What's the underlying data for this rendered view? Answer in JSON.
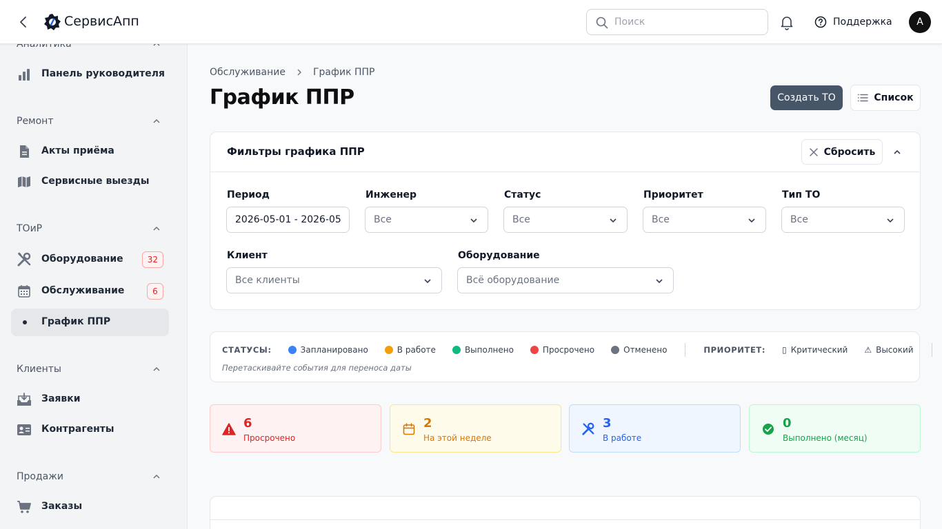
{
  "header": {
    "app_name": "СервисАпп",
    "search_placeholder": "Поиск",
    "support_label": "Поддержка",
    "avatar_initial": "A"
  },
  "sidebar": {
    "sections": [
      {
        "title": "Аналитика",
        "items": [
          {
            "label": "Панель руководителя",
            "icon": "bar-chart-icon"
          }
        ]
      },
      {
        "title": "Ремонт",
        "items": [
          {
            "label": "Акты приёма",
            "icon": "document-icon"
          },
          {
            "label": "Сервисные выезды",
            "icon": "map-icon"
          }
        ]
      },
      {
        "title": "ТОиР",
        "items": [
          {
            "label": "Оборудование",
            "icon": "tools-icon",
            "badge": "32"
          },
          {
            "label": "Обслуживание",
            "icon": "calendar-icon",
            "badge": "6"
          },
          {
            "label": "График ППР",
            "icon": "dot-icon",
            "active": true
          }
        ]
      },
      {
        "title": "Клиенты",
        "items": [
          {
            "label": "Заявки",
            "icon": "inbox-icon"
          },
          {
            "label": "Контрагенты",
            "icon": "contact-card-icon"
          }
        ]
      },
      {
        "title": "Продажи",
        "items": [
          {
            "label": "Заказы",
            "icon": "cart-icon"
          }
        ]
      }
    ]
  },
  "breadcrumb": {
    "parent": "Обслуживание",
    "current": "График ППР"
  },
  "page": {
    "title": "График ППР",
    "create_label": "Создать ТО",
    "list_label": "Список"
  },
  "filters": {
    "title": "Фильтры графика ППР",
    "reset_label": "Сбросить",
    "period": {
      "label": "Период",
      "value": "2026-05-01 - 2026-05"
    },
    "engineer": {
      "label": "Инженер",
      "value": "Все"
    },
    "status": {
      "label": "Статус",
      "value": "Все"
    },
    "priority": {
      "label": "Приоритет",
      "value": "Все"
    },
    "type": {
      "label": "Тип ТО",
      "value": "Все"
    },
    "client": {
      "label": "Клиент",
      "value": "Все клиенты"
    },
    "equipment": {
      "label": "Оборудование",
      "value": "Всё оборудование"
    }
  },
  "legend": {
    "statuses_title": "СТАТУСЫ:",
    "statuses": [
      {
        "label": "Запланировано",
        "color": "#3b82f6"
      },
      {
        "label": "В работе",
        "color": "#f59e0b"
      },
      {
        "label": "Выполнено",
        "color": "#10b981"
      },
      {
        "label": "Просрочено",
        "color": "#ef4444"
      },
      {
        "label": "Отменено",
        "color": "#6b7280"
      }
    ],
    "priority_title": "ПРИОРИТЕТ:",
    "priorities": [
      {
        "label": "Критический",
        "glyph": "▯"
      },
      {
        "label": "Высокий",
        "glyph": "⚠"
      }
    ],
    "hint": "Перетаскивайте события для переноса даты"
  },
  "stats": [
    {
      "value": "6",
      "label": "Просрочено",
      "icon": "warning-icon",
      "color": "#dc2626",
      "bg": "#fef2f2",
      "border": "#fecaca"
    },
    {
      "value": "2",
      "label": "На этой неделе",
      "icon": "calendar-icon",
      "color": "#d97706",
      "bg": "#fffbeb",
      "border": "#fde68a"
    },
    {
      "value": "3",
      "label": "В работе",
      "icon": "tools-icon",
      "color": "#2563eb",
      "bg": "#eff6ff",
      "border": "#bfdbfe"
    },
    {
      "value": "0",
      "label": "Выполнено (месяц)",
      "icon": "check-circle-icon",
      "color": "#16a34a",
      "bg": "#f0fdf4",
      "border": "#bbf7d0"
    }
  ]
}
